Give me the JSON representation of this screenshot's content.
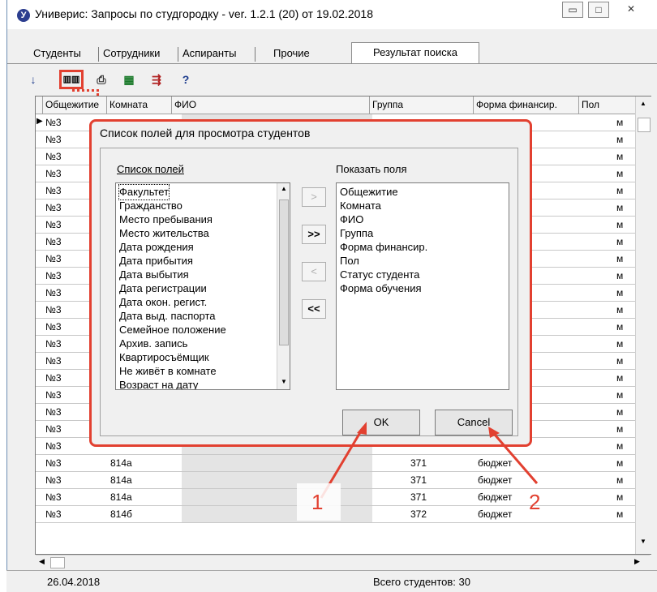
{
  "window": {
    "title": "Универис: Запросы по студгородку  -  ver. 1.2.1 (20) от 19.02.2018",
    "app_icon": "У",
    "minimize": "▭",
    "maximize": "□",
    "close": "✕"
  },
  "tabs": [
    {
      "label": "Студенты"
    },
    {
      "label": "Сотрудники"
    },
    {
      "label": "Аспиранты"
    },
    {
      "label": "Прочие"
    },
    {
      "label": "Результат поиска"
    }
  ],
  "toolbar": {
    "sort_icon": "sort-az-icon",
    "columns_icon": "columns-icon",
    "print_icon": "printer-icon",
    "excel_icon": "excel-icon",
    "export_icon": "export-icon",
    "help": "?"
  },
  "grid": {
    "columns": [
      "Общежитие",
      "Комната",
      "ФИО",
      "Группа",
      "Форма финансир.",
      "Пол"
    ],
    "rows": [
      {
        "dorm": "№3",
        "room": "",
        "group": "",
        "finance": "",
        "sex": "м"
      },
      {
        "dorm": "№3",
        "room": "",
        "group": "",
        "finance": "",
        "sex": "м"
      },
      {
        "dorm": "№3",
        "room": "",
        "group": "",
        "finance": "",
        "sex": "м"
      },
      {
        "dorm": "№3",
        "room": "",
        "group": "",
        "finance": "",
        "sex": "м"
      },
      {
        "dorm": "№3",
        "room": "",
        "group": "",
        "finance": "",
        "sex": "м"
      },
      {
        "dorm": "№3",
        "room": "",
        "group": "",
        "finance": "",
        "sex": "м"
      },
      {
        "dorm": "№3",
        "room": "",
        "group": "",
        "finance": "",
        "sex": "м"
      },
      {
        "dorm": "№3",
        "room": "",
        "group": "",
        "finance": "",
        "sex": "м"
      },
      {
        "dorm": "№3",
        "room": "",
        "group": "",
        "finance": "",
        "sex": "м"
      },
      {
        "dorm": "№3",
        "room": "",
        "group": "",
        "finance": "",
        "sex": "м"
      },
      {
        "dorm": "№3",
        "room": "",
        "group": "",
        "finance": "",
        "sex": "м"
      },
      {
        "dorm": "№3",
        "room": "",
        "group": "",
        "finance": "",
        "sex": "м"
      },
      {
        "dorm": "№3",
        "room": "",
        "group": "",
        "finance": "",
        "sex": "м"
      },
      {
        "dorm": "№3",
        "room": "",
        "group": "",
        "finance": "",
        "sex": "м"
      },
      {
        "dorm": "№3",
        "room": "",
        "group": "",
        "finance": "",
        "sex": "м"
      },
      {
        "dorm": "№3",
        "room": "",
        "group": "",
        "finance": "",
        "sex": "м"
      },
      {
        "dorm": "№3",
        "room": "",
        "group": "",
        "finance": "",
        "sex": "м"
      },
      {
        "dorm": "№3",
        "room": "",
        "group": "",
        "finance": "",
        "sex": "м"
      },
      {
        "dorm": "№3",
        "room": "",
        "group": "",
        "finance": "",
        "sex": "м"
      },
      {
        "dorm": "№3",
        "room": "",
        "group": "",
        "finance": "",
        "sex": "м"
      },
      {
        "dorm": "№3",
        "room": "814а",
        "group": "371",
        "finance": "бюджет",
        "sex": "м"
      },
      {
        "dorm": "№3",
        "room": "814а",
        "group": "371",
        "finance": "бюджет",
        "sex": "м"
      },
      {
        "dorm": "№3",
        "room": "814а",
        "group": "371",
        "finance": "бюджет",
        "sex": "м"
      },
      {
        "dorm": "№3",
        "room": "814б",
        "group": "372",
        "finance": "бюджет",
        "sex": "м"
      }
    ]
  },
  "status": {
    "date": "26.04.2018",
    "total": "Всего студентов: 30"
  },
  "dialog": {
    "title": "Список полей для просмотра студентов",
    "left_label": "Список полей",
    "right_label": "Показать поля",
    "left_items": [
      "Факультет",
      "Гражданство",
      "Место пребывания",
      "Место жительства",
      "Дата рождения",
      "Дата прибытия",
      "Дата выбытия",
      "Дата регистрации",
      "Дата окон. регист.",
      "Дата выд. паспорта",
      "Семейное положение",
      "Архив. запись",
      "Квартиросъёмщик",
      "Не живёт в комнате",
      "Возраст на дату"
    ],
    "right_items": [
      "Общежитие",
      "Комната",
      "ФИО",
      "Группа",
      "Форма финансир.",
      "Пол",
      "Статус студента",
      "Форма обучения"
    ],
    "btn_add": ">",
    "btn_add_all": ">>",
    "btn_remove": "<",
    "btn_remove_all": "<<",
    "ok": "OK",
    "cancel": "Cancel"
  },
  "annotations": {
    "one": "1",
    "two": "2",
    "accent": "#e24030"
  }
}
